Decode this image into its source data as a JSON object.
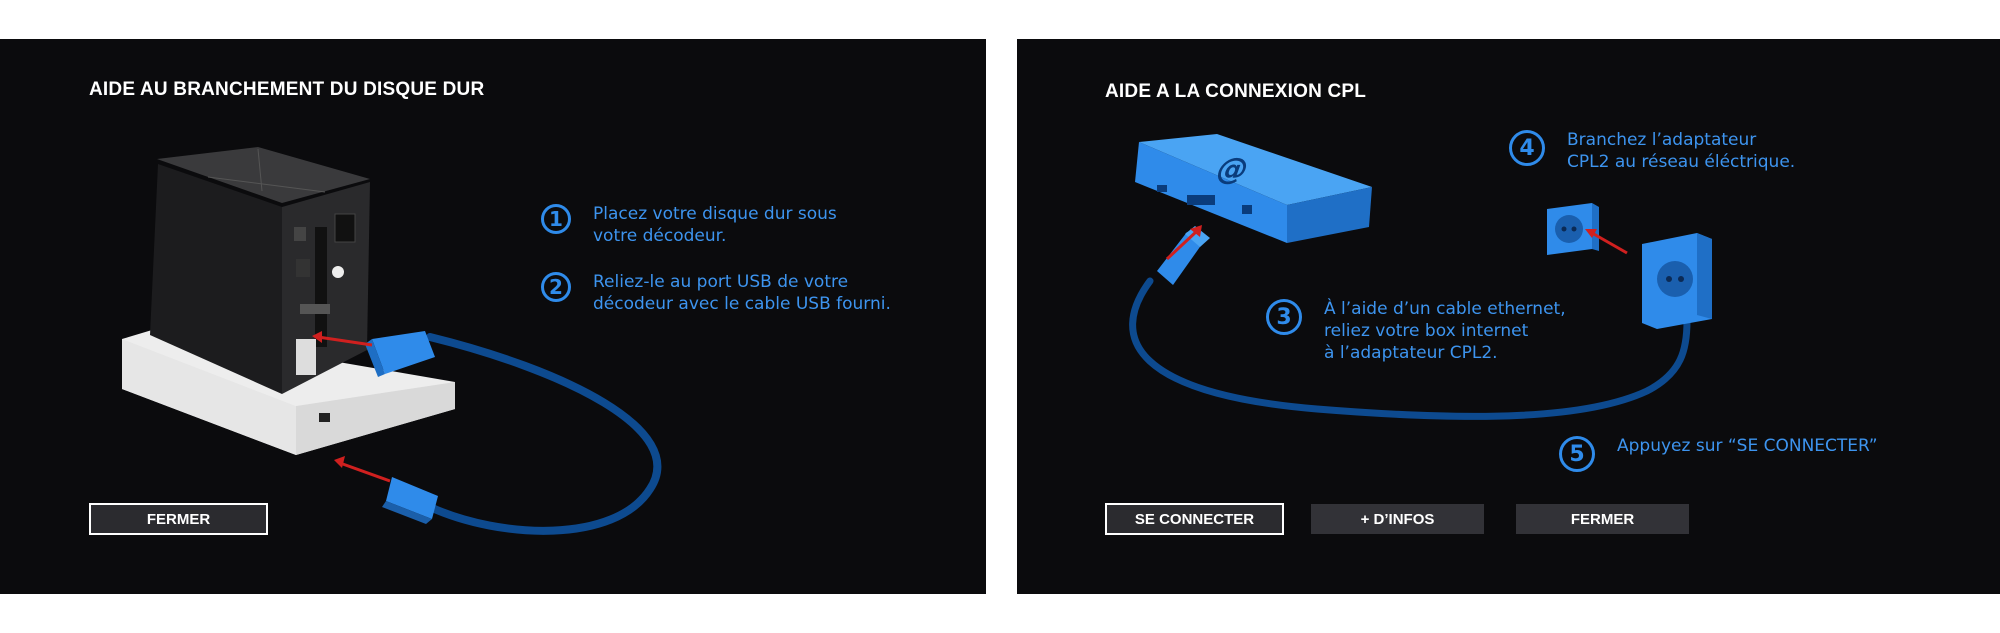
{
  "left": {
    "title": "AIDE AU BRANCHEMENT DU DISQUE DUR",
    "steps": [
      {
        "number": "1",
        "text": "Placez votre disque dur sous\nvotre décodeur."
      },
      {
        "number": "2",
        "text": "Reliez-le au port USB de votre\ndécodeur avec le cable USB fourni."
      }
    ],
    "buttons": {
      "close": "FERMER"
    }
  },
  "right": {
    "title": "AIDE A LA CONNEXION CPL",
    "steps": [
      {
        "number": "3",
        "text": "À l’aide d’un cable ethernet,\nreliez votre box internet\nà l’adaptateur CPL2."
      },
      {
        "number": "4",
        "text": "Branchez l’adaptateur\nCPL2 au réseau éléctrique."
      },
      {
        "number": "5",
        "text": "Appuyez sur “SE CONNECTER”"
      }
    ],
    "buttons": {
      "connect": "SE CONNECTER",
      "more_info": "+ D’INFOS",
      "close": "FERMER"
    },
    "router_symbol": "@"
  },
  "icons": {
    "left": [
      "decoder-cube-icon",
      "hard-drive-base-icon",
      "usb-cable-icon"
    ],
    "right": [
      "internet-box-icon",
      "ethernet-cable-icon",
      "wall-socket-icon",
      "cpl-adapter-icon"
    ]
  },
  "colors": {
    "panel_bg": "#0b0b0d",
    "accent_blue": "#2f8bea",
    "button_bg": "#323237",
    "arrow_red": "#d0201f"
  }
}
